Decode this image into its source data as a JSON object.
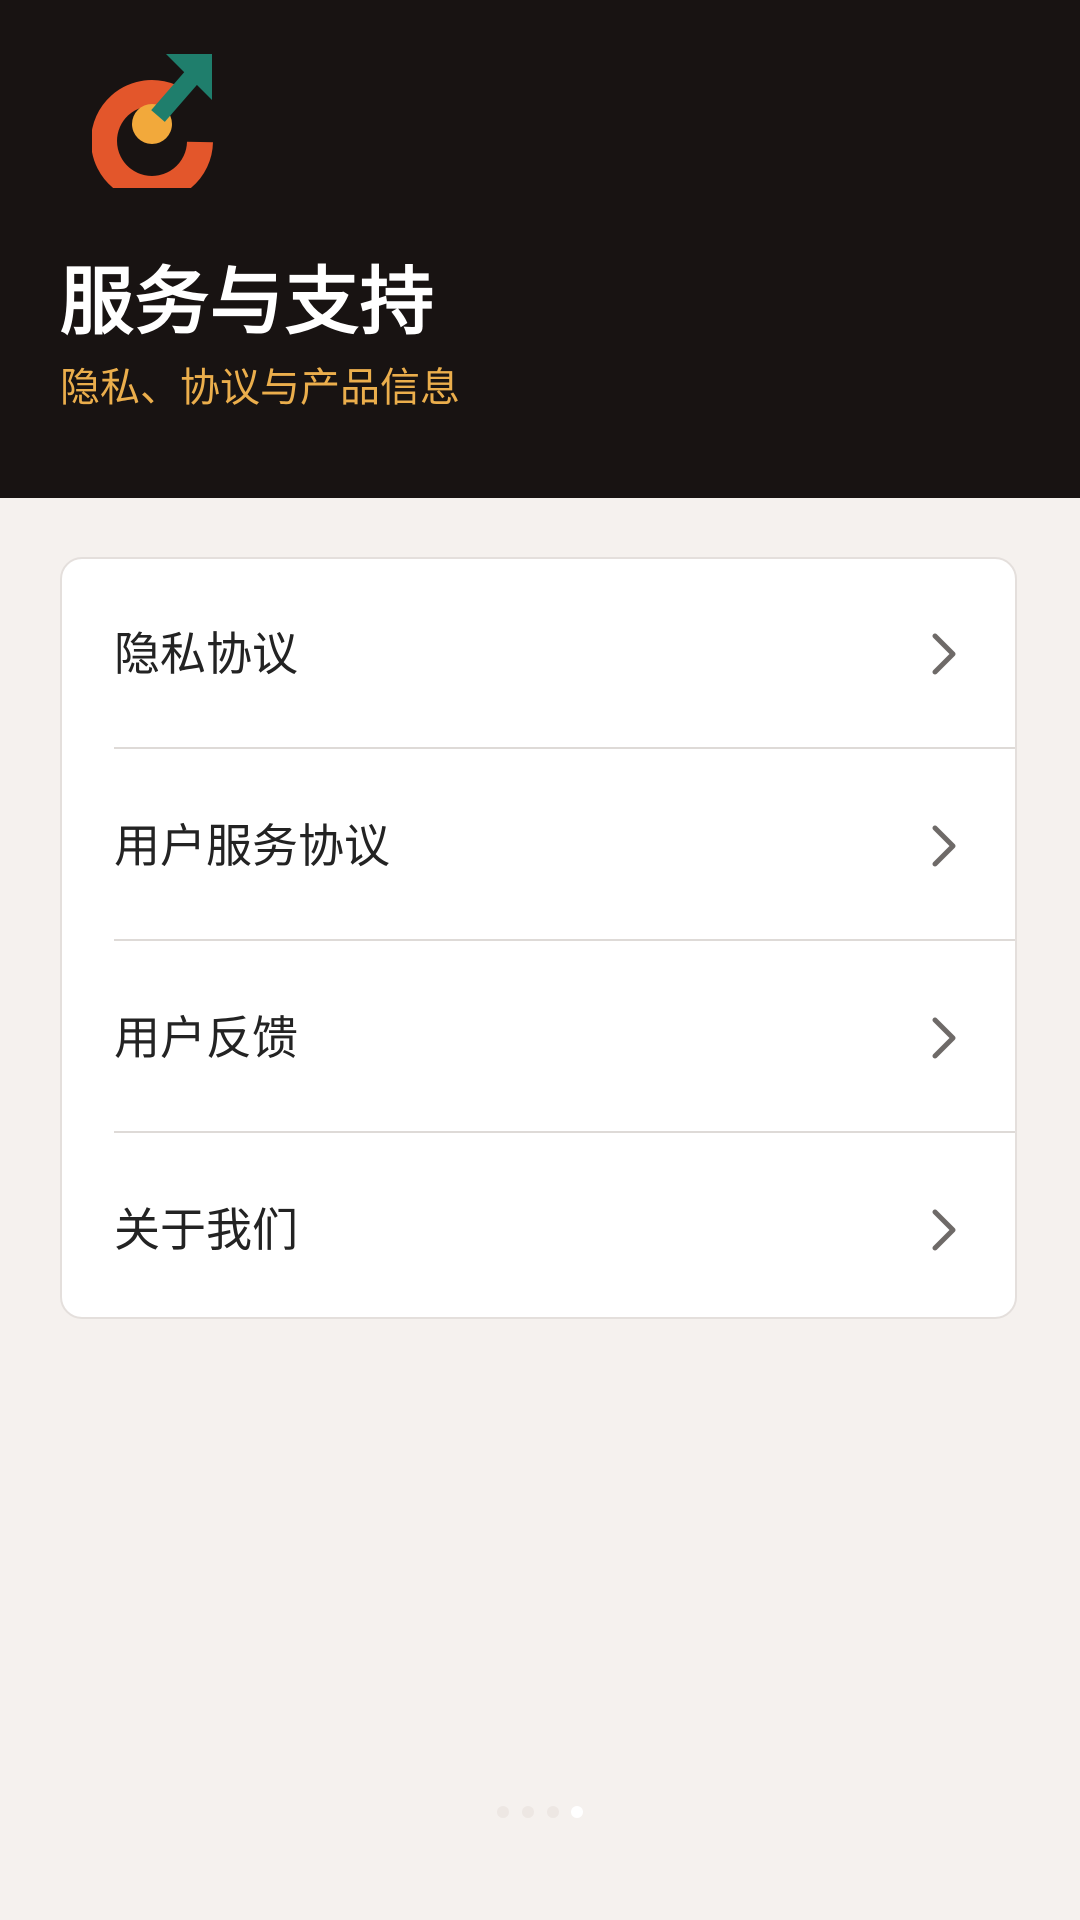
{
  "header": {
    "title": "服务与支持",
    "subtitle": "隐私、协议与产品信息",
    "logo_icon": "target-growth-arrow-icon",
    "colors": {
      "background": "#181312",
      "subtitle": "#ebae4c",
      "logo_ring": "#e3562b",
      "logo_dot": "#f2a93b",
      "logo_arrow": "#1f7e6c"
    }
  },
  "menu": {
    "items": [
      {
        "label": "隐私协议",
        "icon": "chevron-right-icon"
      },
      {
        "label": "用户服务协议",
        "icon": "chevron-right-icon"
      },
      {
        "label": "用户反馈",
        "icon": "chevron-right-icon"
      },
      {
        "label": "关于我们",
        "icon": "chevron-right-icon"
      }
    ]
  },
  "pager": {
    "total": 4,
    "current": 4
  },
  "colors": {
    "page_background": "#f5f1ee",
    "card_background": "#ffffff",
    "chevron": "#6e6a68"
  }
}
